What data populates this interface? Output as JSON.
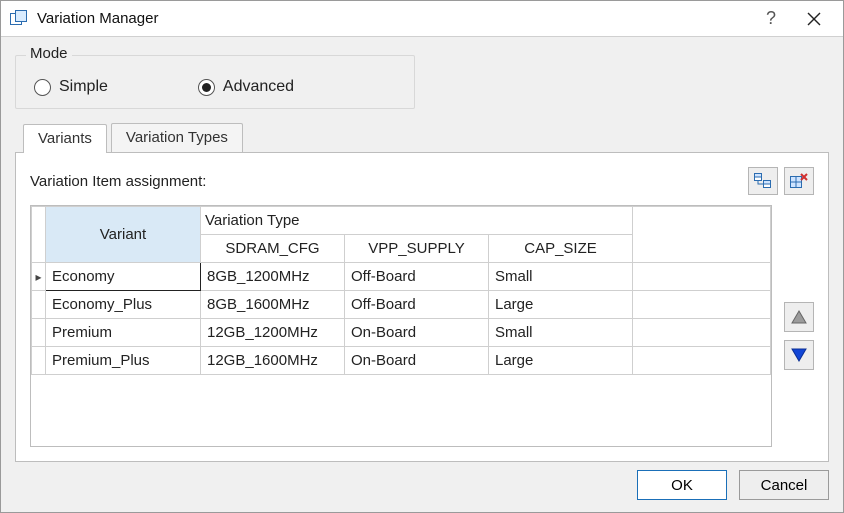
{
  "window": {
    "title": "Variation Manager",
    "helpSymbol": "?",
    "closeSymbol": "✕"
  },
  "mode": {
    "groupLabel": "Mode",
    "options": [
      {
        "label": "Simple",
        "selected": false
      },
      {
        "label": "Advanced",
        "selected": true
      }
    ]
  },
  "tabs": [
    {
      "label": "Variants",
      "active": true
    },
    {
      "label": "Variation Types",
      "active": false
    }
  ],
  "panel": {
    "assignmentLabel": "Variation Item assignment:"
  },
  "grid": {
    "variantHeader": "Variant",
    "groupHeader": "Variation Type",
    "subHeaders": [
      "SDRAM_CFG",
      "VPP_SUPPLY",
      "CAP_SIZE"
    ],
    "rows": [
      {
        "marker": "▸",
        "variant": "Economy",
        "cells": [
          "8GB_1200MHz",
          "Off-Board",
          "Small"
        ],
        "selectedCell": 0
      },
      {
        "marker": "",
        "variant": "Economy_Plus",
        "cells": [
          "8GB_1600MHz",
          "Off-Board",
          "Large"
        ]
      },
      {
        "marker": "",
        "variant": "Premium",
        "cells": [
          "12GB_1200MHz",
          "On-Board",
          "Small"
        ]
      },
      {
        "marker": "",
        "variant": "Premium_Plus",
        "cells": [
          "12GB_1600MHz",
          "On-Board",
          "Large"
        ]
      }
    ]
  },
  "buttons": {
    "ok": "OK",
    "cancel": "Cancel"
  }
}
